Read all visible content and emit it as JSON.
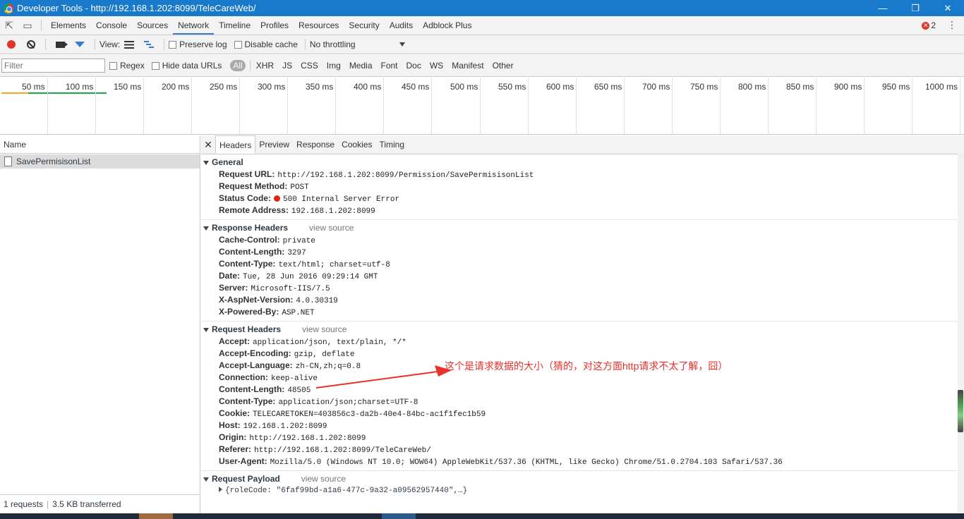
{
  "window": {
    "title": "Developer Tools - http://192.168.1.202:8099/TeleCareWeb/"
  },
  "devtools": {
    "tabs": [
      "Elements",
      "Console",
      "Sources",
      "Network",
      "Timeline",
      "Profiles",
      "Resources",
      "Security",
      "Audits",
      "Adblock Plus"
    ],
    "active_tab": "Network",
    "error_count": "2"
  },
  "network_toolbar": {
    "view_label": "View:",
    "preserve_log": "Preserve log",
    "disable_cache": "Disable cache",
    "throttling": "No throttling"
  },
  "filter_bar": {
    "placeholder": "Filter",
    "regex": "Regex",
    "hide_data_urls": "Hide data URLs",
    "types": [
      "All",
      "XHR",
      "JS",
      "CSS",
      "Img",
      "Media",
      "Font",
      "Doc",
      "WS",
      "Manifest",
      "Other"
    ]
  },
  "timeline": {
    "ticks": [
      "50 ms",
      "100 ms",
      "150 ms",
      "200 ms",
      "250 ms",
      "300 ms",
      "350 ms",
      "400 ms",
      "450 ms",
      "500 ms",
      "550 ms",
      "600 ms",
      "650 ms",
      "700 ms",
      "750 ms",
      "800 ms",
      "850 ms",
      "900 ms",
      "950 ms",
      "1000 ms"
    ]
  },
  "request_list": {
    "column_name": "Name",
    "items": [
      "SavePermisisonList"
    ],
    "status": {
      "requests": "1 requests",
      "transferred": "3.5 KB transferred"
    }
  },
  "details": {
    "tabs": [
      "Headers",
      "Preview",
      "Response",
      "Cookies",
      "Timing"
    ],
    "active_tab": "Headers",
    "view_source": "view source",
    "general": {
      "title": "General",
      "rows": [
        {
          "key": "Request URL:",
          "value": "http://192.168.1.202:8099/Permission/SavePermisisonList"
        },
        {
          "key": "Request Method:",
          "value": "POST"
        },
        {
          "key": "Status Code:",
          "value": "500 Internal Server Error"
        },
        {
          "key": "Remote Address:",
          "value": "192.168.1.202:8099"
        }
      ]
    },
    "response_headers": {
      "title": "Response Headers",
      "rows": [
        {
          "key": "Cache-Control:",
          "value": "private"
        },
        {
          "key": "Content-Length:",
          "value": "3297"
        },
        {
          "key": "Content-Type:",
          "value": "text/html; charset=utf-8"
        },
        {
          "key": "Date:",
          "value": "Tue, 28 Jun 2016 09:29:14 GMT"
        },
        {
          "key": "Server:",
          "value": "Microsoft-IIS/7.5"
        },
        {
          "key": "X-AspNet-Version:",
          "value": "4.0.30319"
        },
        {
          "key": "X-Powered-By:",
          "value": "ASP.NET"
        }
      ]
    },
    "request_headers": {
      "title": "Request Headers",
      "rows": [
        {
          "key": "Accept:",
          "value": "application/json, text/plain, */*"
        },
        {
          "key": "Accept-Encoding:",
          "value": "gzip, deflate"
        },
        {
          "key": "Accept-Language:",
          "value": "zh-CN,zh;q=0.8"
        },
        {
          "key": "Connection:",
          "value": "keep-alive"
        },
        {
          "key": "Content-Length:",
          "value": "48505"
        },
        {
          "key": "Content-Type:",
          "value": "application/json;charset=UTF-8"
        },
        {
          "key": "Cookie:",
          "value": "TELECARETOKEN=403856c3-da2b-40e4-84bc-ac1f1fec1b59"
        },
        {
          "key": "Host:",
          "value": "192.168.1.202:8099"
        },
        {
          "key": "Origin:",
          "value": "http://192.168.1.202:8099"
        },
        {
          "key": "Referer:",
          "value": "http://192.168.1.202:8099/TeleCareWeb/"
        },
        {
          "key": "User-Agent:",
          "value": "Mozilla/5.0 (Windows NT 10.0; WOW64) AppleWebKit/537.36 (KHTML, like Gecko) Chrome/51.0.2704.103 Safari/537.36"
        }
      ]
    },
    "request_payload": {
      "title": "Request Payload",
      "value": "{roleCode: \"6faf99bd-a1a6-477c-9a32-a09562957440\",…}"
    }
  },
  "annotation": {
    "text": "这个是请求数据的大小（猜的，对这方面http请求不太了解，囧）",
    "color": "#e8312a"
  }
}
